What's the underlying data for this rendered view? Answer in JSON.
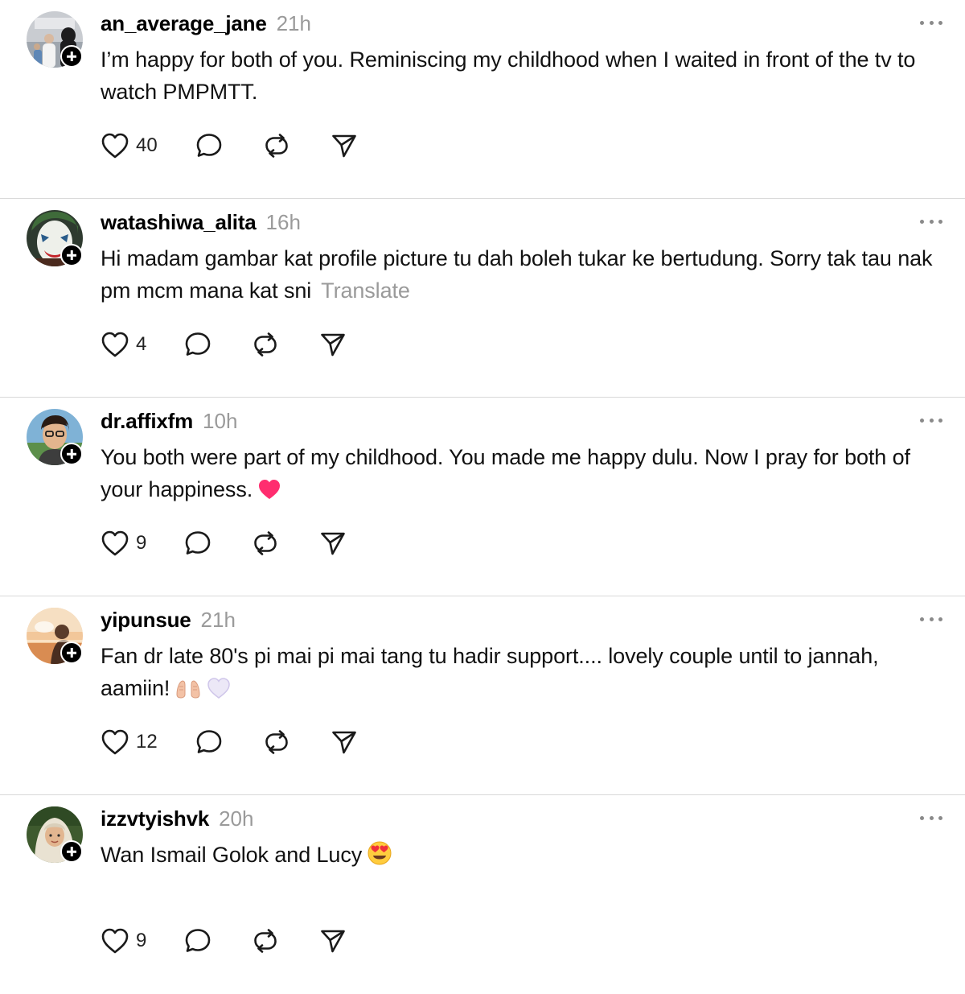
{
  "comments": [
    {
      "username": "an_average_jane",
      "time": "21h",
      "text": "I’m happy for both of you. Reminiscing my childhood when I waited in front of the tv to watch PMPMTT.",
      "likes": "40",
      "translate": ""
    },
    {
      "username": "watashiwa_alita",
      "time": "16h",
      "text": "Hi madam gambar kat profile picture tu dah boleh tukar ke bertudung. Sorry tak tau nak pm mcm mana kat sni",
      "likes": "4",
      "translate": "Translate"
    },
    {
      "username": "dr.affixfm",
      "time": "10h",
      "text": "You both were part of my childhood. You made me happy dulu. Now I pray for both of your happiness.",
      "likes": "9",
      "translate": ""
    },
    {
      "username": "yipunsue",
      "time": "21h",
      "text": "Fan dr late 80's pi mai pi mai tang tu hadir support.... lovely couple until to jannah, aamiin!",
      "likes": "12",
      "translate": ""
    },
    {
      "username": "izzvtyishvk",
      "time": "20h",
      "text": "Wan Ismail Golok and Lucy",
      "likes": "9",
      "translate": ""
    }
  ],
  "icons": {
    "like": "heart-icon",
    "reply": "comment-bubble-icon",
    "repost": "repost-icon",
    "share": "send-icon",
    "more": "more-dots-icon",
    "follow": "plus-icon"
  },
  "colors": {
    "text": "#111111",
    "muted": "#9a9a9a",
    "divider": "#d9d9d9",
    "heart_emoji": "#ff2d6f"
  }
}
